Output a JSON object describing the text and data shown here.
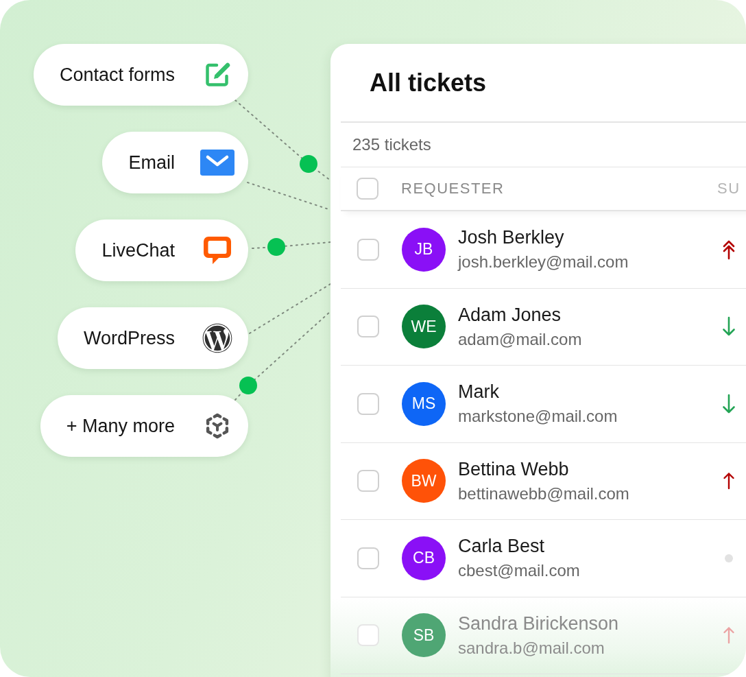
{
  "sources": [
    {
      "label": "Contact forms",
      "kind": "form"
    },
    {
      "label": "Email",
      "kind": "email"
    },
    {
      "label": "LiveChat",
      "kind": "chat"
    },
    {
      "label": "WordPress",
      "kind": "wordpress"
    },
    {
      "label": "+ Many more",
      "kind": "more"
    }
  ],
  "tickets": {
    "title": "All tickets",
    "count": "235 tickets",
    "header": {
      "checked": false,
      "columns": [
        "REQUESTER",
        "SU"
      ]
    },
    "rows": [
      {
        "initials": "JB",
        "color": "#8a10f6",
        "name": "Josh Berkley",
        "email": "josh.berkley@mail.com",
        "checked": false,
        "faded": false,
        "priority": {
          "kind": "urgent"
        }
      },
      {
        "initials": "WE",
        "color": "#0b7f3a",
        "name": "Adam Jones",
        "email": "adam@mail.com",
        "checked": false,
        "faded": false,
        "priority": {
          "kind": "low"
        }
      },
      {
        "initials": "MS",
        "color": "#0e66f6",
        "name": "Mark",
        "email": "markstone@mail.com",
        "checked": false,
        "faded": false,
        "priority": {
          "kind": "low"
        }
      },
      {
        "initials": "BW",
        "color": "#ff5208",
        "name": "Bettina Webb",
        "email": "bettinawebb@mail.com",
        "checked": false,
        "faded": false,
        "priority": {
          "kind": "high"
        }
      },
      {
        "initials": "CB",
        "color": "#8a10f6",
        "name": "Carla Best",
        "email": "cbest@mail.com",
        "checked": false,
        "faded": false,
        "priority": {
          "kind": "none"
        }
      },
      {
        "initials": "SB",
        "color": "#4fa674",
        "name": "Sandra Birickenson",
        "email": "sandra.b@mail.com",
        "checked": false,
        "faded": true,
        "priority": {
          "kind": "high"
        }
      }
    ]
  }
}
